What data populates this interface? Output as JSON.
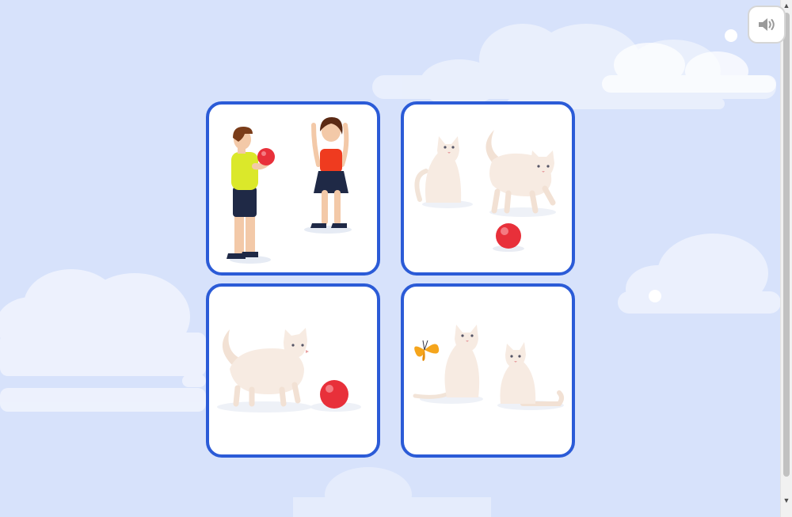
{
  "header": {
    "sound_button": {
      "icon": "speaker-icon"
    }
  },
  "answer_cards": [
    {
      "id": "children-ball",
      "icon": "children-playing-ball-illustration"
    },
    {
      "id": "two-cats-ball",
      "icon": "two-cats-and-ball-illustration"
    },
    {
      "id": "cat-ball",
      "icon": "cat-with-ball-illustration"
    },
    {
      "id": "cats-butterfly",
      "icon": "cats-and-butterfly-illustration"
    }
  ],
  "colors": {
    "background": "#d7e2fb",
    "card_border": "#2b5bd7",
    "ball": "#e8303a",
    "cat_fur": "#f7ebe2"
  }
}
